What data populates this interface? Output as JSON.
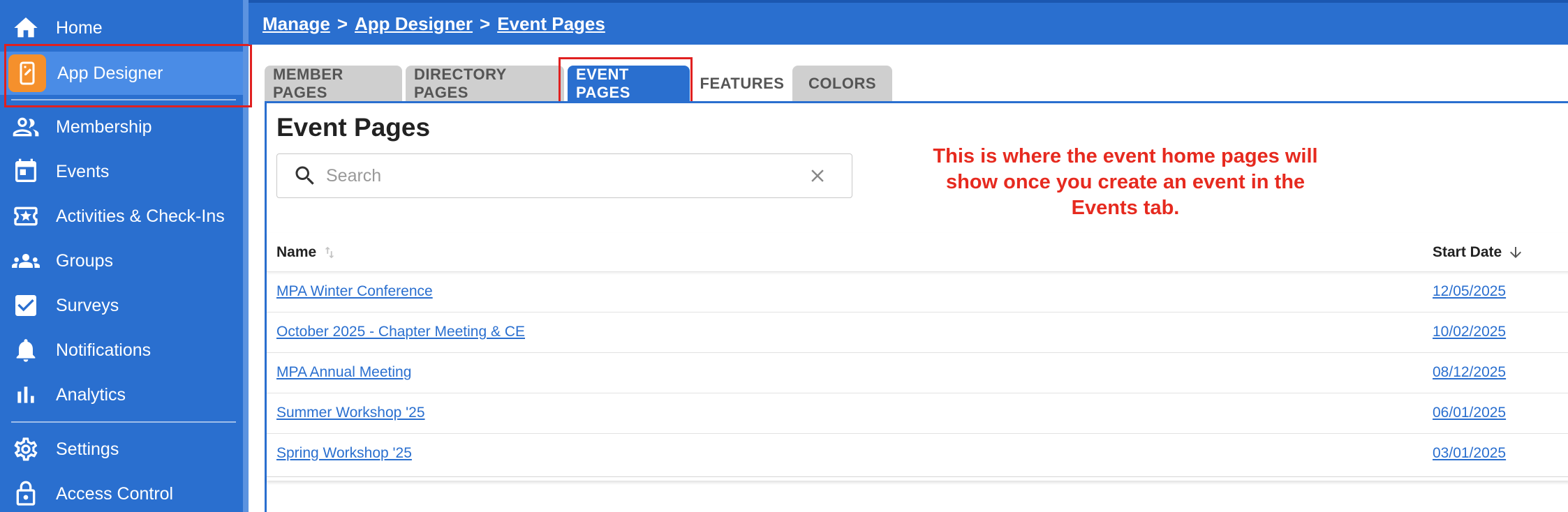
{
  "sidebar": {
    "items": [
      {
        "label": "Home",
        "icon": "home-icon"
      },
      {
        "label": "App Designer",
        "icon": "app-designer-icon"
      },
      {
        "label": "Membership",
        "icon": "people-icon"
      },
      {
        "label": "Events",
        "icon": "calendar-icon"
      },
      {
        "label": "Activities & Check-Ins",
        "icon": "ticket-star-icon"
      },
      {
        "label": "Groups",
        "icon": "groups-icon"
      },
      {
        "label": "Surveys",
        "icon": "checkbox-icon"
      },
      {
        "label": "Notifications",
        "icon": "bell-icon"
      },
      {
        "label": "Analytics",
        "icon": "bar-chart-icon"
      },
      {
        "label": "Settings",
        "icon": "gear-icon"
      },
      {
        "label": "Access Control",
        "icon": "lock-icon"
      }
    ],
    "active": "App Designer"
  },
  "breadcrumb": {
    "items": [
      "Manage",
      "App Designer",
      "Event Pages"
    ],
    "separator": ">"
  },
  "tabs": [
    {
      "label": "MEMBER PAGES"
    },
    {
      "label": "DIRECTORY PAGES"
    },
    {
      "label": "EVENT PAGES"
    },
    {
      "label": "FEATURES"
    },
    {
      "label": "COLORS"
    }
  ],
  "main": {
    "title": "Event Pages",
    "search": {
      "placeholder": "Search",
      "value": ""
    },
    "annotation": "This is where the event home pages will show once you create an event in the Events tab.",
    "table": {
      "columns": [
        "Name",
        "Start Date"
      ],
      "rows": [
        {
          "name": "MPA Winter Conference",
          "start_date": "12/05/2025"
        },
        {
          "name": "October 2025 - Chapter Meeting & CE",
          "start_date": "10/02/2025"
        },
        {
          "name": "MPA Annual Meeting",
          "start_date": "08/12/2025"
        },
        {
          "name": "Summer Workshop '25",
          "start_date": "06/01/2025"
        },
        {
          "name": "Spring Workshop '25",
          "start_date": "03/01/2025"
        }
      ]
    }
  },
  "colors": {
    "primary_blue": "#2a6fcf",
    "active_nav": "#4a8ce6",
    "app_icon_orange": "#f5902c",
    "annotation_red": "#e62a1f"
  }
}
